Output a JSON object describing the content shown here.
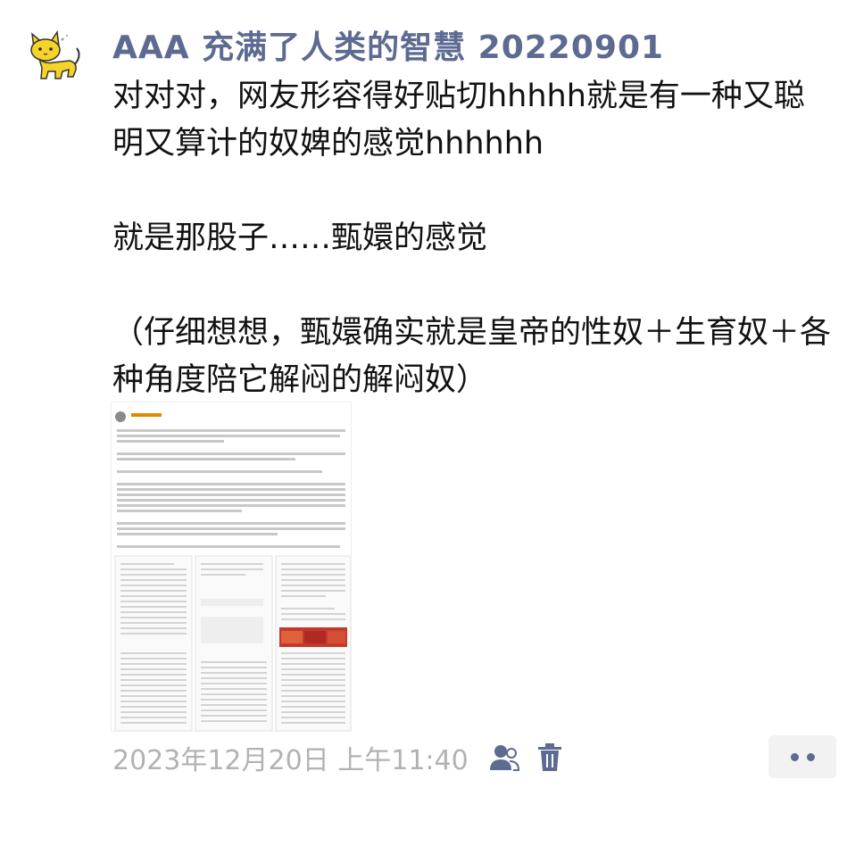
{
  "post": {
    "username": "AAA 充满了人类的智慧 20220901",
    "paragraphs": [
      "对对对，网友形容得好贴切hhhhh就是有一种又聪明又算计的奴婢的感觉hhhhhh",
      "就是那股子……甄嬛的感觉",
      "（仔细想想，甄嬛确实就是皇帝的性奴＋生育奴＋各种角度陪它解闷的解闷奴）"
    ],
    "timestamp": "2023年12月20日 上午11:40",
    "colors": {
      "username": "#5d6a91",
      "body": "#111111",
      "timestamp": "#b2b2b2",
      "icon": "#5d6a91"
    },
    "icons": {
      "avatar": "yellow-cat-avatar",
      "visibility": "friends-visibility-icon",
      "delete": "trash-icon",
      "more": "more-dots-icon"
    }
  }
}
